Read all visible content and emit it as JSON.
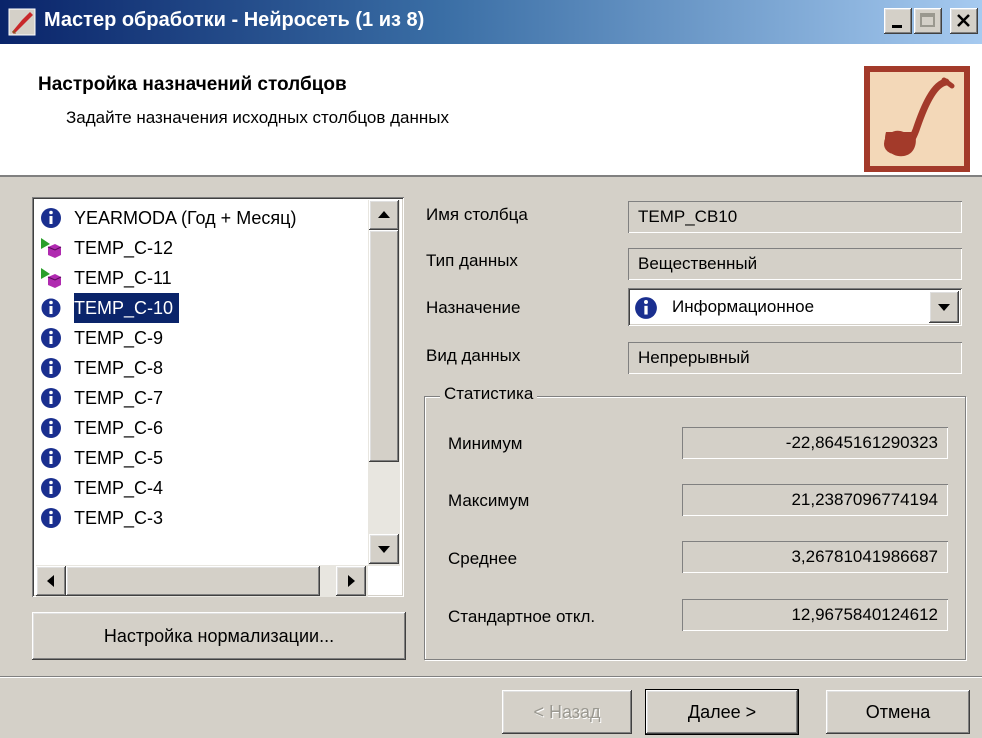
{
  "window": {
    "title": "Мастер обработки - Нейросеть (1 из 8)",
    "minimize_glyph": "_",
    "close_glyph": "×"
  },
  "header": {
    "title": "Настройка назначений столбцов",
    "subtitle": "Задайте назначения исходных столбцов данных"
  },
  "columns_list": {
    "items": [
      {
        "label": "YEARMODA (Год + Месяц)",
        "icon": "info-icon",
        "selected": false
      },
      {
        "label": "TEMP_C-12",
        "icon": "input-cube-icon",
        "selected": false
      },
      {
        "label": "TEMP_C-11",
        "icon": "input-cube-icon",
        "selected": false
      },
      {
        "label": "TEMP_C-10",
        "icon": "info-icon",
        "selected": true
      },
      {
        "label": "TEMP_C-9",
        "icon": "info-icon",
        "selected": false
      },
      {
        "label": "TEMP_C-8",
        "icon": "info-icon",
        "selected": false
      },
      {
        "label": "TEMP_C-7",
        "icon": "info-icon",
        "selected": false
      },
      {
        "label": "TEMP_C-6",
        "icon": "info-icon",
        "selected": false
      },
      {
        "label": "TEMP_C-5",
        "icon": "info-icon",
        "selected": false
      },
      {
        "label": "TEMP_C-4",
        "icon": "info-icon",
        "selected": false
      },
      {
        "label": "TEMP_C-3",
        "icon": "info-icon",
        "selected": false
      }
    ]
  },
  "normalization_button": "Настройка нормализации...",
  "details": {
    "column_name_label": "Имя столбца",
    "column_name_value": "TEMP_CB10",
    "data_type_label": "Тип данных",
    "data_type_value": "Вещественный",
    "purpose_label": "Назначение",
    "purpose_value": "Информационное",
    "data_kind_label": "Вид данных",
    "data_kind_value": "Непрерывный"
  },
  "statistics": {
    "title": "Статистика",
    "min_label": "Минимум",
    "min_value": "-22,8645161290323",
    "max_label": "Максимум",
    "max_value": "21,2387096774194",
    "mean_label": "Среднее",
    "mean_value": "3,26781041986687",
    "std_label": "Стандартное откл.",
    "std_value": "12,9675840124612"
  },
  "footer": {
    "back_label": "< Назад",
    "next_label": "Далее >",
    "cancel_label": "Отмена"
  },
  "colors": {
    "selection": "#0a246a",
    "window_bg": "#d4d0c8",
    "info_icon": "#1a2f8f",
    "logo_bg": "#a33a2a"
  }
}
